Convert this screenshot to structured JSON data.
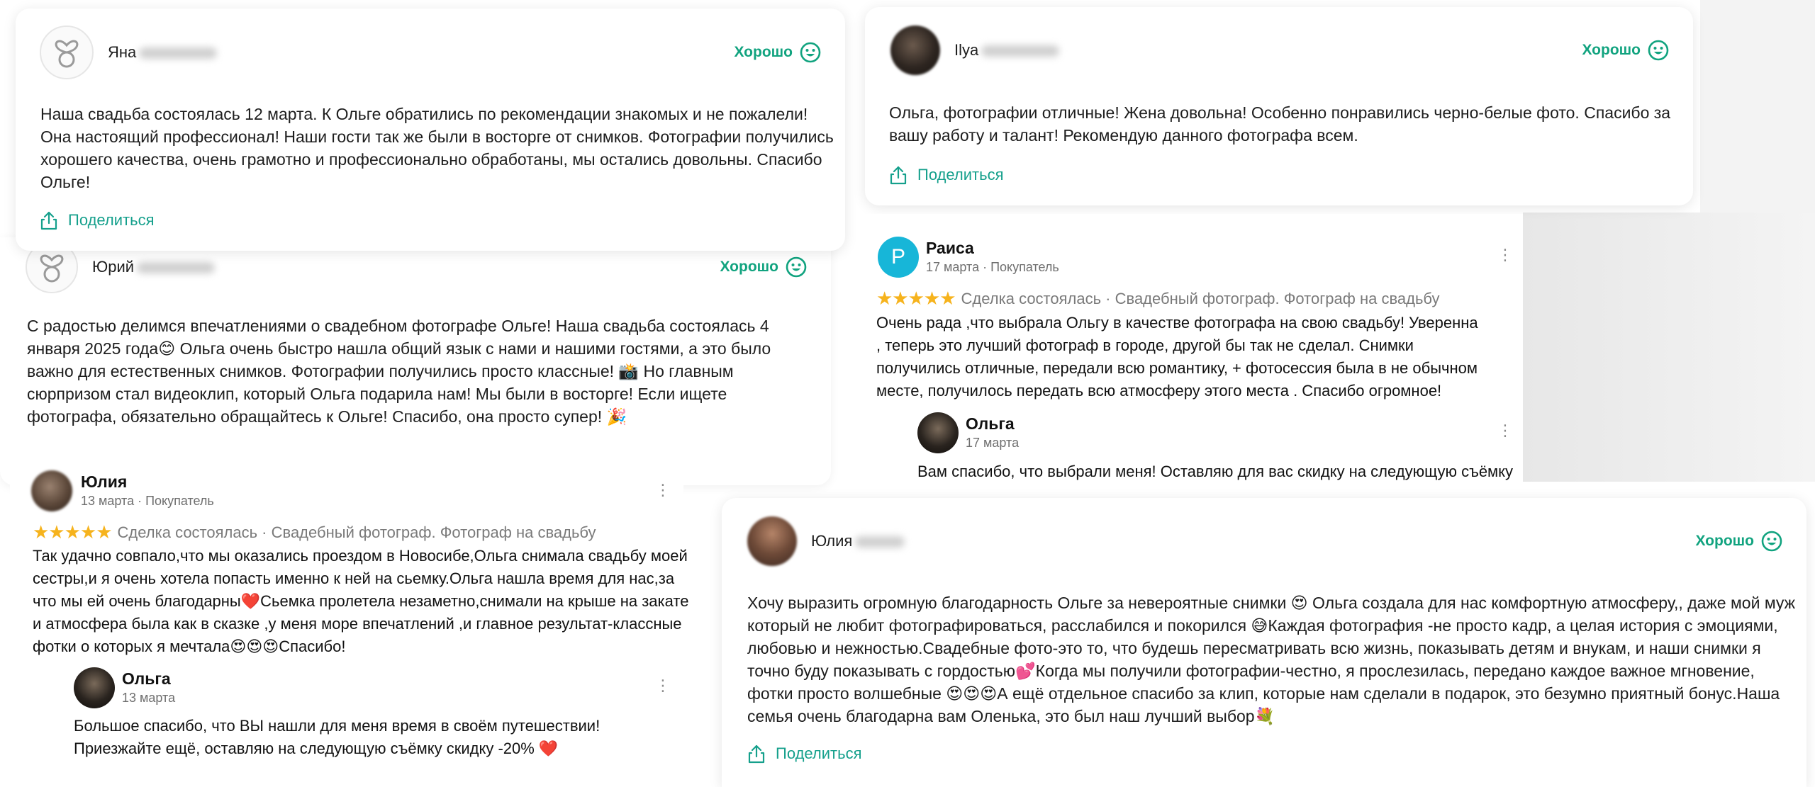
{
  "rating_label": "Хорошо",
  "share_label": "Поделиться",
  "review1": {
    "author": "Яна",
    "text": "Наша свадьба состоялась 12 марта. К Ольге обратились по рекомендации знакомых и не пожалели! Она настоящий профессионал! Наши гости так же были в восторге от снимков. Фотографии получились хорошего качества, очень грамотно и профессионально обработаны, мы остались довольны. Спасибо Ольге!"
  },
  "review2": {
    "author": "Ilya",
    "text": "Ольга, фотографии отличные! Жена довольна! Особенно понравились черно-белые фото. Спасибо за вашу работу и талант! Рекомендую данного фотографа всем."
  },
  "review3": {
    "author": "Юрий",
    "text": "С радостью делимся впечатлениями о свадебном фотографе Ольге! Наша свадьба состоялась 4 января 2025 года😊 Ольга очень быстро нашла общий язык с нами и нашими гостями, а это было важно для естественных снимков. Фотографии получились просто классные! 📸 Но главным сюрпризом стал видеоклип, который Ольга подарила нам! Мы были в восторге! Если ищете фотографа, обязательно обращайтесь к Ольге! Спасибо, она просто супер! 🎉"
  },
  "review4": {
    "avatar_letter": "Р",
    "author": "Раиса",
    "meta": "17 марта · Покупатель",
    "stars": "★★★★★",
    "deal": "Сделка состоялась · Свадебный фотограф. Фотограф на свадьбу",
    "text": "Очень рада ,что выбрала Ольгу в качестве фотографа на свою свадьбу! Уверенна , теперь это лучший фотограф в городе, другой бы так не сделал. Снимки получились отличные, передали всю романтику, + фотосессия была в не обычном месте, получилось передать всю атмосферу этого места . Спасибо огромное!",
    "reply_author": "Ольга",
    "reply_date": "17 марта",
    "reply_text": "Вам спасибо, что выбрали меня! Оставляю для вас скидку на следующую съёмку"
  },
  "review5": {
    "author": "Юлия",
    "meta": "13 марта · Покупатель",
    "stars": "★★★★★",
    "deal": "Сделка состоялась · Свадебный фотограф. Фотограф на свадьбу",
    "text": "Так удачно совпало,что мы оказались проездом в Новосибе,Ольга снимала свадьбу моей сестры,и я очень хотела попасть именно к ней на сьемку.Ольга нашла время для нас,за что мы ей очень благодарны❤️Сьемка пролетела незаметно,снимали на крыше на закате и атмосфера была как в сказке ,у меня море впечатлений ,и главное результат-классные фотки о которых я мечтала😍😍😍Спасибо!",
    "reply_author": "Ольга",
    "reply_date": "13 марта",
    "reply_text": "Большое спасибо, что ВЫ нашли для меня время в своём путешествии! Приезжайте ещё, оставляю на следующую съёмку скидку -20% ❤️"
  },
  "review6": {
    "author": "Юлия",
    "text": "Хочу выразить огромную благодарность Ольге за невероятные снимки 😍 Ольга создала для нас комфортную атмосферу,, даже мой муж который не любит фотографироваться, расслабился и покорился 😅Каждая фотография -не просто кадр, а целая история с эмоциями, любовью и нежностью.Свадебные фото-это то, что будешь пересматривать всю жизнь, показывать детям и внукам, и наши снимки я точно буду показывать с гордостью💕Когда мы получили фотографии-честно, я прослезилась, передано каждое важное мгновение, фотки просто волшебные 😍😍😍А ещё отдельное спасибо за клип, которые нам сделали в подарок, это безумно приятный бонус.Наша семья очень благодарна вам Оленька, это был наш лучший выбор💐"
  },
  "colors": {
    "accent_green": "#11a37f",
    "share_teal": "#15a08c",
    "star": "#f6b31d",
    "letter_avatar": "#17b6d8"
  }
}
